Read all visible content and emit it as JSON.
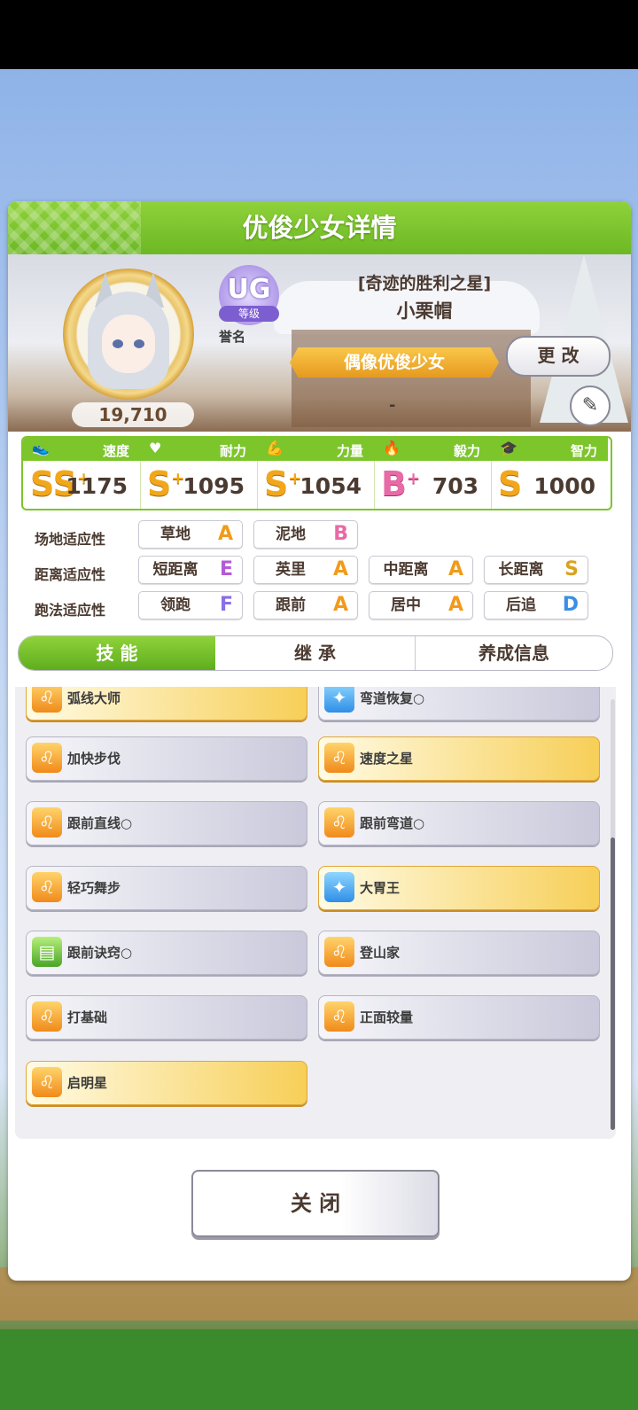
{
  "dialog": {
    "title": "优俊少女详情"
  },
  "profile": {
    "fans": "19,710",
    "rank_letters": "UG",
    "rank_label": "等级",
    "honor_label": "誉名",
    "epithet": "[奇迹的胜利之星]",
    "name": "小栗帽",
    "tag": "偶像优俊少女",
    "change_label": "更 改",
    "subtitle": "-"
  },
  "stats": [
    {
      "icon": "shoe-icon",
      "label": "速度",
      "grade": "SS",
      "plus": "+",
      "value": "1175"
    },
    {
      "icon": "heart-icon",
      "label": "耐力",
      "grade": "S",
      "plus": "+",
      "value": "1095"
    },
    {
      "icon": "muscle-icon",
      "label": "力量",
      "grade": "S",
      "plus": "+",
      "value": "1054"
    },
    {
      "icon": "flame-icon",
      "label": "毅力",
      "grade": "B",
      "plus": "+",
      "value": "703"
    },
    {
      "icon": "graduation-cap-icon",
      "label": "智力",
      "grade": "S",
      "plus": "",
      "value": "1000"
    }
  ],
  "aptitude": {
    "track": {
      "label": "场地适应性",
      "items": [
        {
          "name": "草地",
          "grade": "A"
        },
        {
          "name": "泥地",
          "grade": "B"
        }
      ]
    },
    "distance": {
      "label": "距离适应性",
      "items": [
        {
          "name": "短距离",
          "grade": "E"
        },
        {
          "name": "英里",
          "grade": "A"
        },
        {
          "name": "中距离",
          "grade": "A"
        },
        {
          "name": "长距离",
          "grade": "S"
        }
      ]
    },
    "style": {
      "label": "跑法适应性",
      "items": [
        {
          "name": "领跑",
          "grade": "F"
        },
        {
          "name": "跟前",
          "grade": "A"
        },
        {
          "name": "居中",
          "grade": "A"
        },
        {
          "name": "后追",
          "grade": "D"
        }
      ]
    }
  },
  "tabs": [
    "技 能",
    "继 承",
    "养成信息"
  ],
  "skills": [
    {
      "name": "弧线大师",
      "gold": true,
      "icon": "lion-icon",
      "marker": ""
    },
    {
      "name": "弯道恢复",
      "gold": false,
      "icon": "sparkle-icon",
      "marker": "○"
    },
    {
      "name": "加快步伐",
      "gold": false,
      "icon": "lion-icon",
      "marker": ""
    },
    {
      "name": "速度之星",
      "gold": true,
      "icon": "lion-icon",
      "marker": ""
    },
    {
      "name": "跟前直线",
      "gold": false,
      "icon": "lion-icon",
      "marker": "○"
    },
    {
      "name": "跟前弯道",
      "gold": false,
      "icon": "lion-icon",
      "marker": "○"
    },
    {
      "name": "轻巧舞步",
      "gold": false,
      "icon": "lion-icon",
      "marker": ""
    },
    {
      "name": "大胃王",
      "gold": true,
      "icon": "sparkle-icon",
      "marker": ""
    },
    {
      "name": "跟前诀窍",
      "gold": false,
      "icon": "book-icon",
      "marker": "○"
    },
    {
      "name": "登山家",
      "gold": false,
      "icon": "lion-icon",
      "marker": ""
    },
    {
      "name": "打基础",
      "gold": false,
      "icon": "lion-icon",
      "marker": ""
    },
    {
      "name": "正面较量",
      "gold": false,
      "icon": "lion-icon",
      "marker": ""
    },
    {
      "name": "启明星",
      "gold": true,
      "icon": "lion-icon",
      "marker": ""
    }
  ],
  "close_label": "关 闭",
  "colors": {
    "accent_green": "#7cc52b",
    "gold": "#f2a71a",
    "pink_grade": "#e86aa6"
  }
}
